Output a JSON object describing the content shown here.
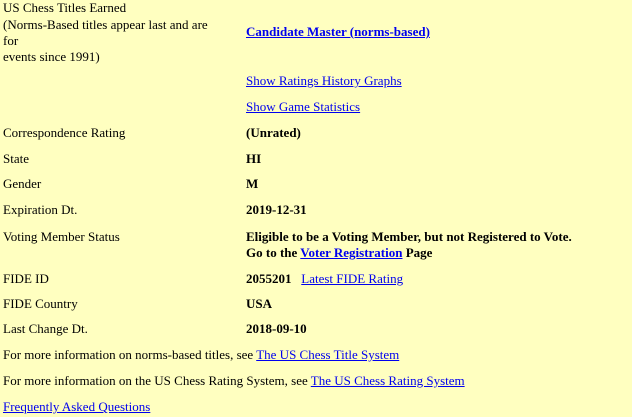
{
  "titles": {
    "label_lines": [
      "US Chess Titles Earned",
      "(Norms-Based titles appear last and are",
      "for",
      "events since 1991)"
    ],
    "value": "Candidate Master (norms-based)"
  },
  "links": {
    "ratings_history": "Show Ratings History Graphs",
    "game_stats": "Show Game Statistics"
  },
  "rows": [
    {
      "label": "Correspondence Rating",
      "value": "(Unrated)"
    },
    {
      "label": "State",
      "value": "HI"
    },
    {
      "label": "Gender",
      "value": "M"
    },
    {
      "label": "Expiration Dt.",
      "value": "2019-12-31"
    }
  ],
  "voting": {
    "label": "Voting Member Status",
    "line1": "Eligible to be a Voting Member, but not Registered to Vote.",
    "line2_pre": "Go to the",
    "link": "Voter Registration",
    "line2_post": "Page"
  },
  "fide": {
    "label": "FIDE ID",
    "value": "2055201",
    "link": "Latest FIDE Rating",
    "country_label": "FIDE Country",
    "country_value": "USA"
  },
  "last_change": {
    "label": "Last Change Dt.",
    "value": "2018-09-10"
  },
  "footer": {
    "norms_text": "For more information on norms-based titles, see",
    "norms_link": "The US Chess Title System",
    "rating_text": "For more information on the US Chess Rating System, see",
    "rating_link": "The US Chess Rating System",
    "faq_link": "Frequently Asked Questions"
  },
  "colors": {
    "background": "#ffffc0",
    "link": "#0000ee"
  }
}
